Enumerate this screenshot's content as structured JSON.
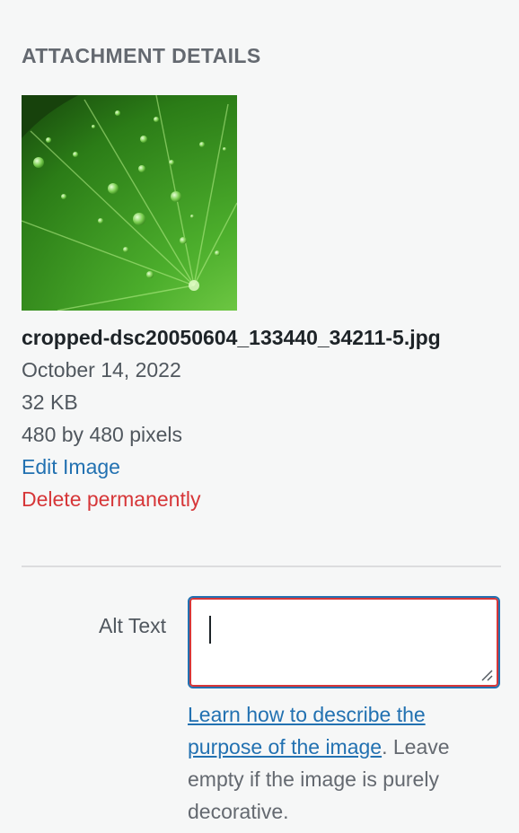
{
  "heading": "ATTACHMENT DETAILS",
  "thumbnail": {
    "alt": "green leaf with water droplets"
  },
  "details": {
    "filename": "cropped-dsc20050604_133440_34211-5.jpg",
    "date": "October 14, 2022",
    "size": "32 KB",
    "dimensions": "480 by 480 pixels",
    "edit_link": "Edit Image",
    "delete_link": "Delete permanently"
  },
  "alt_text": {
    "label": "Alt Text",
    "value": "",
    "help_link": "Learn how to describe the purpose of the image",
    "help_text": ". Leave empty if the image is purely decorative."
  },
  "colors": {
    "link": "#2271b1",
    "danger": "#d63638",
    "background": "#f6f7f7"
  }
}
